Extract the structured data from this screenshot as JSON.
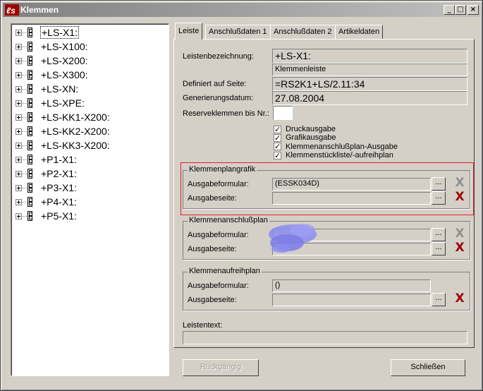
{
  "window": {
    "title": "Klemmen",
    "minimize_glyph": "_",
    "maximize_glyph": "□",
    "close_glyph": "×"
  },
  "tree": {
    "items": [
      {
        "label": "+LS-X1:"
      },
      {
        "label": "+LS-X100:"
      },
      {
        "label": "+LS-X200:"
      },
      {
        "label": "+LS-X300:"
      },
      {
        "label": "+LS-XN:"
      },
      {
        "label": "+LS-XPE:"
      },
      {
        "label": "+LS-KK1-X200:"
      },
      {
        "label": "+LS-KK2-X200:"
      },
      {
        "label": "+LS-KK3-X200:"
      },
      {
        "label": "+P1-X1:"
      },
      {
        "label": "+P2-X1:"
      },
      {
        "label": "+P3-X1:"
      },
      {
        "label": "+P4-X1:"
      },
      {
        "label": "+P5-X1:"
      }
    ]
  },
  "tabs": [
    {
      "label": "Leiste"
    },
    {
      "label": "Anschlußdaten 1"
    },
    {
      "label": "Anschlußdaten 2"
    },
    {
      "label": "Artikeldaten"
    }
  ],
  "form": {
    "leistenbezeichnung_label": "Leistenbezeichnung:",
    "leistenbezeichnung_value": "+LS-X1:",
    "leistenbezeichnung_sub": "Klemmenleiste",
    "definiert_label": "Definiert auf Seite:",
    "definiert_value": "=RS2K1+LS/2.11:34",
    "generierungsdatum_label": "Generierungsdatum:",
    "generierungsdatum_value": "27.08.2004",
    "reserve_label": "Reserveklemmen bis Nr.:",
    "reserve_value": "",
    "check_mark": "✓",
    "checkboxes": [
      {
        "label": "Druckausgabe",
        "checked": true
      },
      {
        "label": "Grafikausgabe",
        "checked": true
      },
      {
        "label": "Klemmenanschlußplan-Ausgabe",
        "checked": true
      },
      {
        "label": "Klemmenstückliste/-aufreihplan",
        "checked": true
      }
    ]
  },
  "groups": {
    "plangrafik": {
      "title": "Klemmenplangrafik",
      "formular_label": "Ausgabeformular:",
      "formular_value": "(ESSK034D)",
      "seite_label": "Ausgabeseite:",
      "seite_value": ""
    },
    "anschlussplan": {
      "title": "Klemmenanschlußplan",
      "formular_label": "Ausgabeformular:",
      "formular_value": "",
      "seite_label": "Ausgabeseite:",
      "seite_value": ""
    },
    "aufreihplan": {
      "title": "Klemmenaufreihplan",
      "formular_label": "Ausgabeformular:",
      "formular_value": "()",
      "seite_label": "Ausgabeseite:",
      "seite_value": ""
    }
  },
  "leistentext": {
    "label": "Leistentext:",
    "value": ""
  },
  "buttons": {
    "dots": "...",
    "delete_glyph": "X",
    "rueckgaengig": "Rückgängig",
    "schliessen": "Schließen"
  },
  "colors": {
    "delete_active": "#a00000",
    "delete_disabled": "#909090",
    "highlight": "#e02020"
  }
}
